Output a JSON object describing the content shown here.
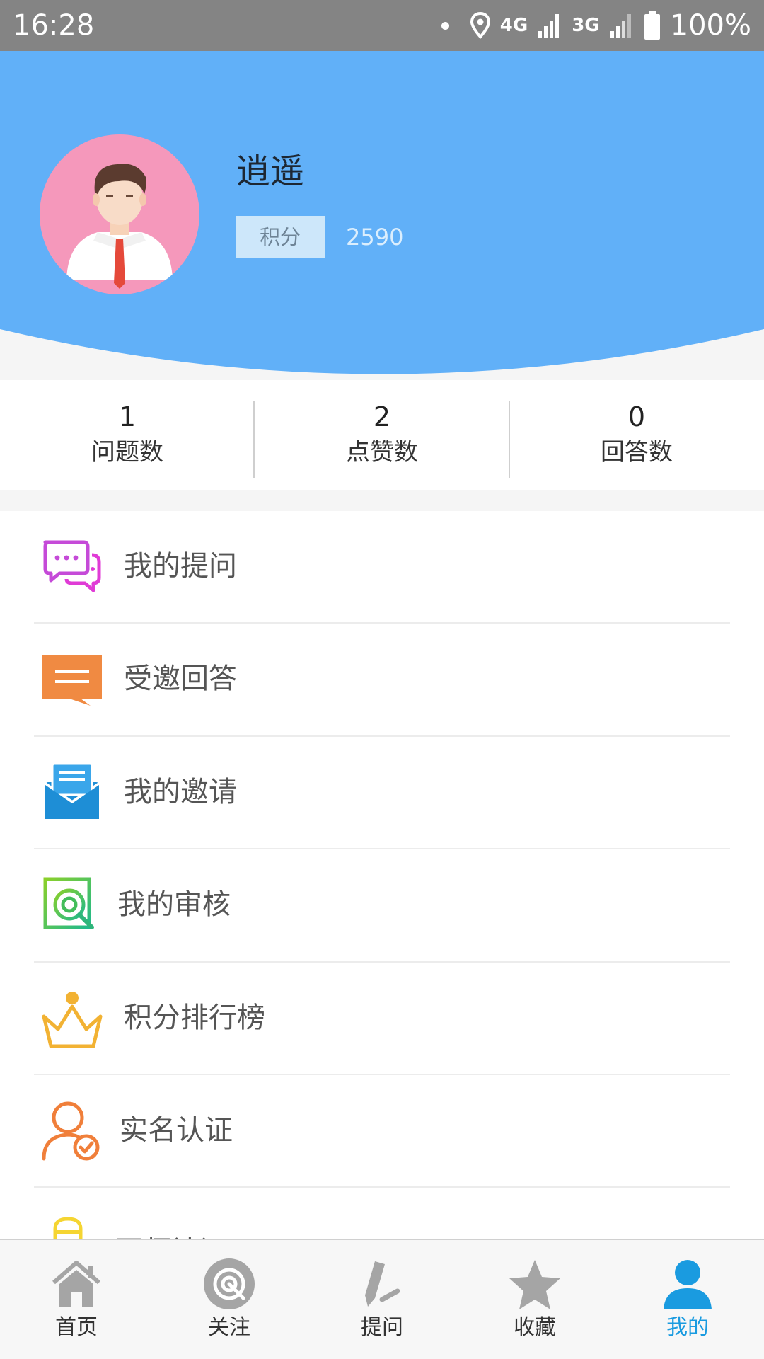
{
  "status_bar": {
    "time": "16:28",
    "network_4g": "4G",
    "network_3g": "3G",
    "battery": "100%"
  },
  "profile": {
    "name": "逍遥",
    "points_label": "积分",
    "points_value": "2590"
  },
  "stats": [
    {
      "count": "1",
      "label": "问题数"
    },
    {
      "count": "2",
      "label": "点赞数"
    },
    {
      "count": "0",
      "label": "回答数"
    }
  ],
  "menu": {
    "items": [
      {
        "label": "我的提问",
        "icon": "chat-bubbles-icon"
      },
      {
        "label": "受邀回答",
        "icon": "message-icon"
      },
      {
        "label": "我的邀请",
        "icon": "envelope-icon"
      },
      {
        "label": "我的审核",
        "icon": "review-icon"
      },
      {
        "label": "积分排行榜",
        "icon": "crown-icon"
      },
      {
        "label": "实名认证",
        "icon": "verified-user-icon"
      },
      {
        "label": "医师认证",
        "icon": "doctor-icon"
      }
    ]
  },
  "bottom_nav": {
    "items": [
      {
        "label": "首页",
        "icon": "home-icon"
      },
      {
        "label": "关注",
        "icon": "target-icon"
      },
      {
        "label": "提问",
        "icon": "pen-icon"
      },
      {
        "label": "收藏",
        "icon": "star-icon"
      },
      {
        "label": "我的",
        "icon": "person-icon",
        "active": true
      }
    ]
  },
  "colors": {
    "header_blue": "#61b0f8",
    "accent": "#1a9be0",
    "status_bar": "#848484"
  }
}
